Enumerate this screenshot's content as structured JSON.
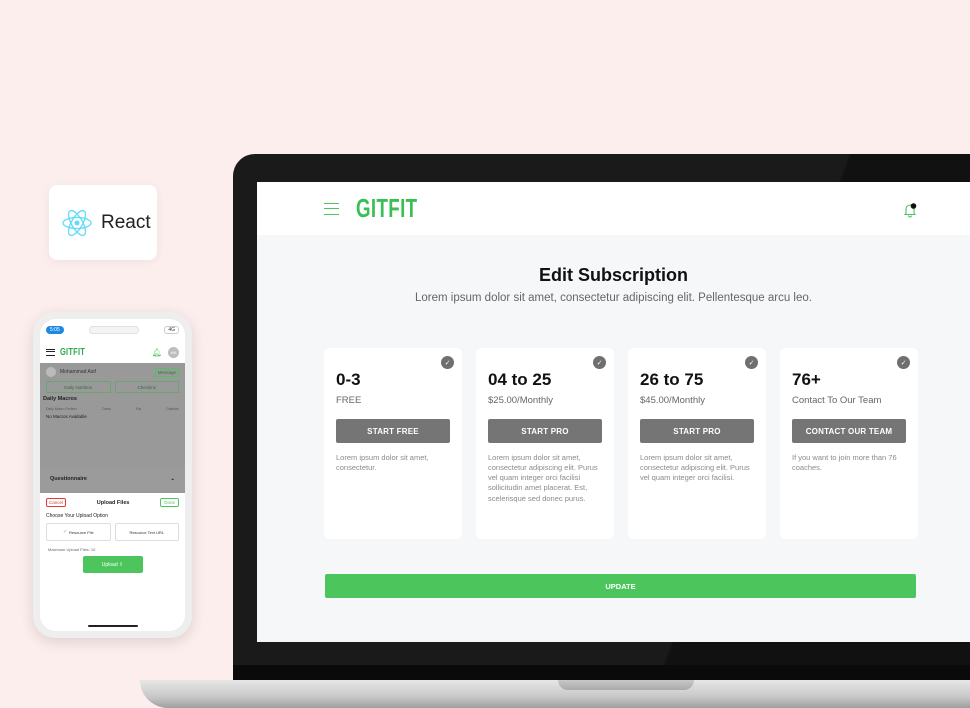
{
  "react_badge": {
    "label": "React"
  },
  "phone": {
    "status": {
      "time": "5:05",
      "signal": "4G"
    },
    "header": {
      "logo": "GITFIT",
      "avatar_initials": "MA"
    },
    "user": {
      "name": "Mohammad Asif",
      "message_label": "Message"
    },
    "tabs": [
      "Daily Nutrition",
      "Checkins"
    ],
    "daily_macros": {
      "title": "Daily Macros",
      "columns": [
        "Daily Macro Protein",
        "Carbs",
        "Fat",
        "Calories"
      ],
      "empty": "No Macros Available"
    },
    "questionnaire": "Questionnaire",
    "sheet": {
      "cancel": "Cancel",
      "title": "Upload Files",
      "done": "Done",
      "choose": "Choose Your Upload Option",
      "options": [
        "Resource File",
        "Resource Text URL"
      ],
      "max_files": "Maximum Upload Files: 10",
      "upload": "Upload"
    }
  },
  "app": {
    "logo": "GITFIT",
    "title": "Edit Subscription",
    "subtitle": "Lorem ipsum dolor sit amet, consectetur adipiscing elit. Pellentesque arcu leo.",
    "plans": [
      {
        "range": "0-3",
        "price": "FREE",
        "button": "START FREE",
        "desc": "Lorem ipsum dolor sit amet, consectetur."
      },
      {
        "range": "04 to 25",
        "price": "$25.00/Monthly",
        "button": "START PRO",
        "desc": "Lorem ipsum dolor sit amet, consectetur adipiscing elit. Purus vel quam integer orci facilisi sollicitudin amet placerat. Est, scelerisque sed donec purus."
      },
      {
        "range": "26 to 75",
        "price": "$45.00/Monthly",
        "button": "START PRO",
        "desc": "Lorem ipsum dolor sit amet, consectetur adipiscing elit. Purus vel quam integer orci facilisi."
      },
      {
        "range": "76+",
        "price": "Contact To Our Team",
        "button": "CONTACT OUR TEAM",
        "desc": "If you want to join more than 76 coaches."
      }
    ],
    "update_label": "UPDATE"
  },
  "colors": {
    "accent": "#4cc55d",
    "background": "#fbeeec",
    "button_gray": "#757575"
  }
}
